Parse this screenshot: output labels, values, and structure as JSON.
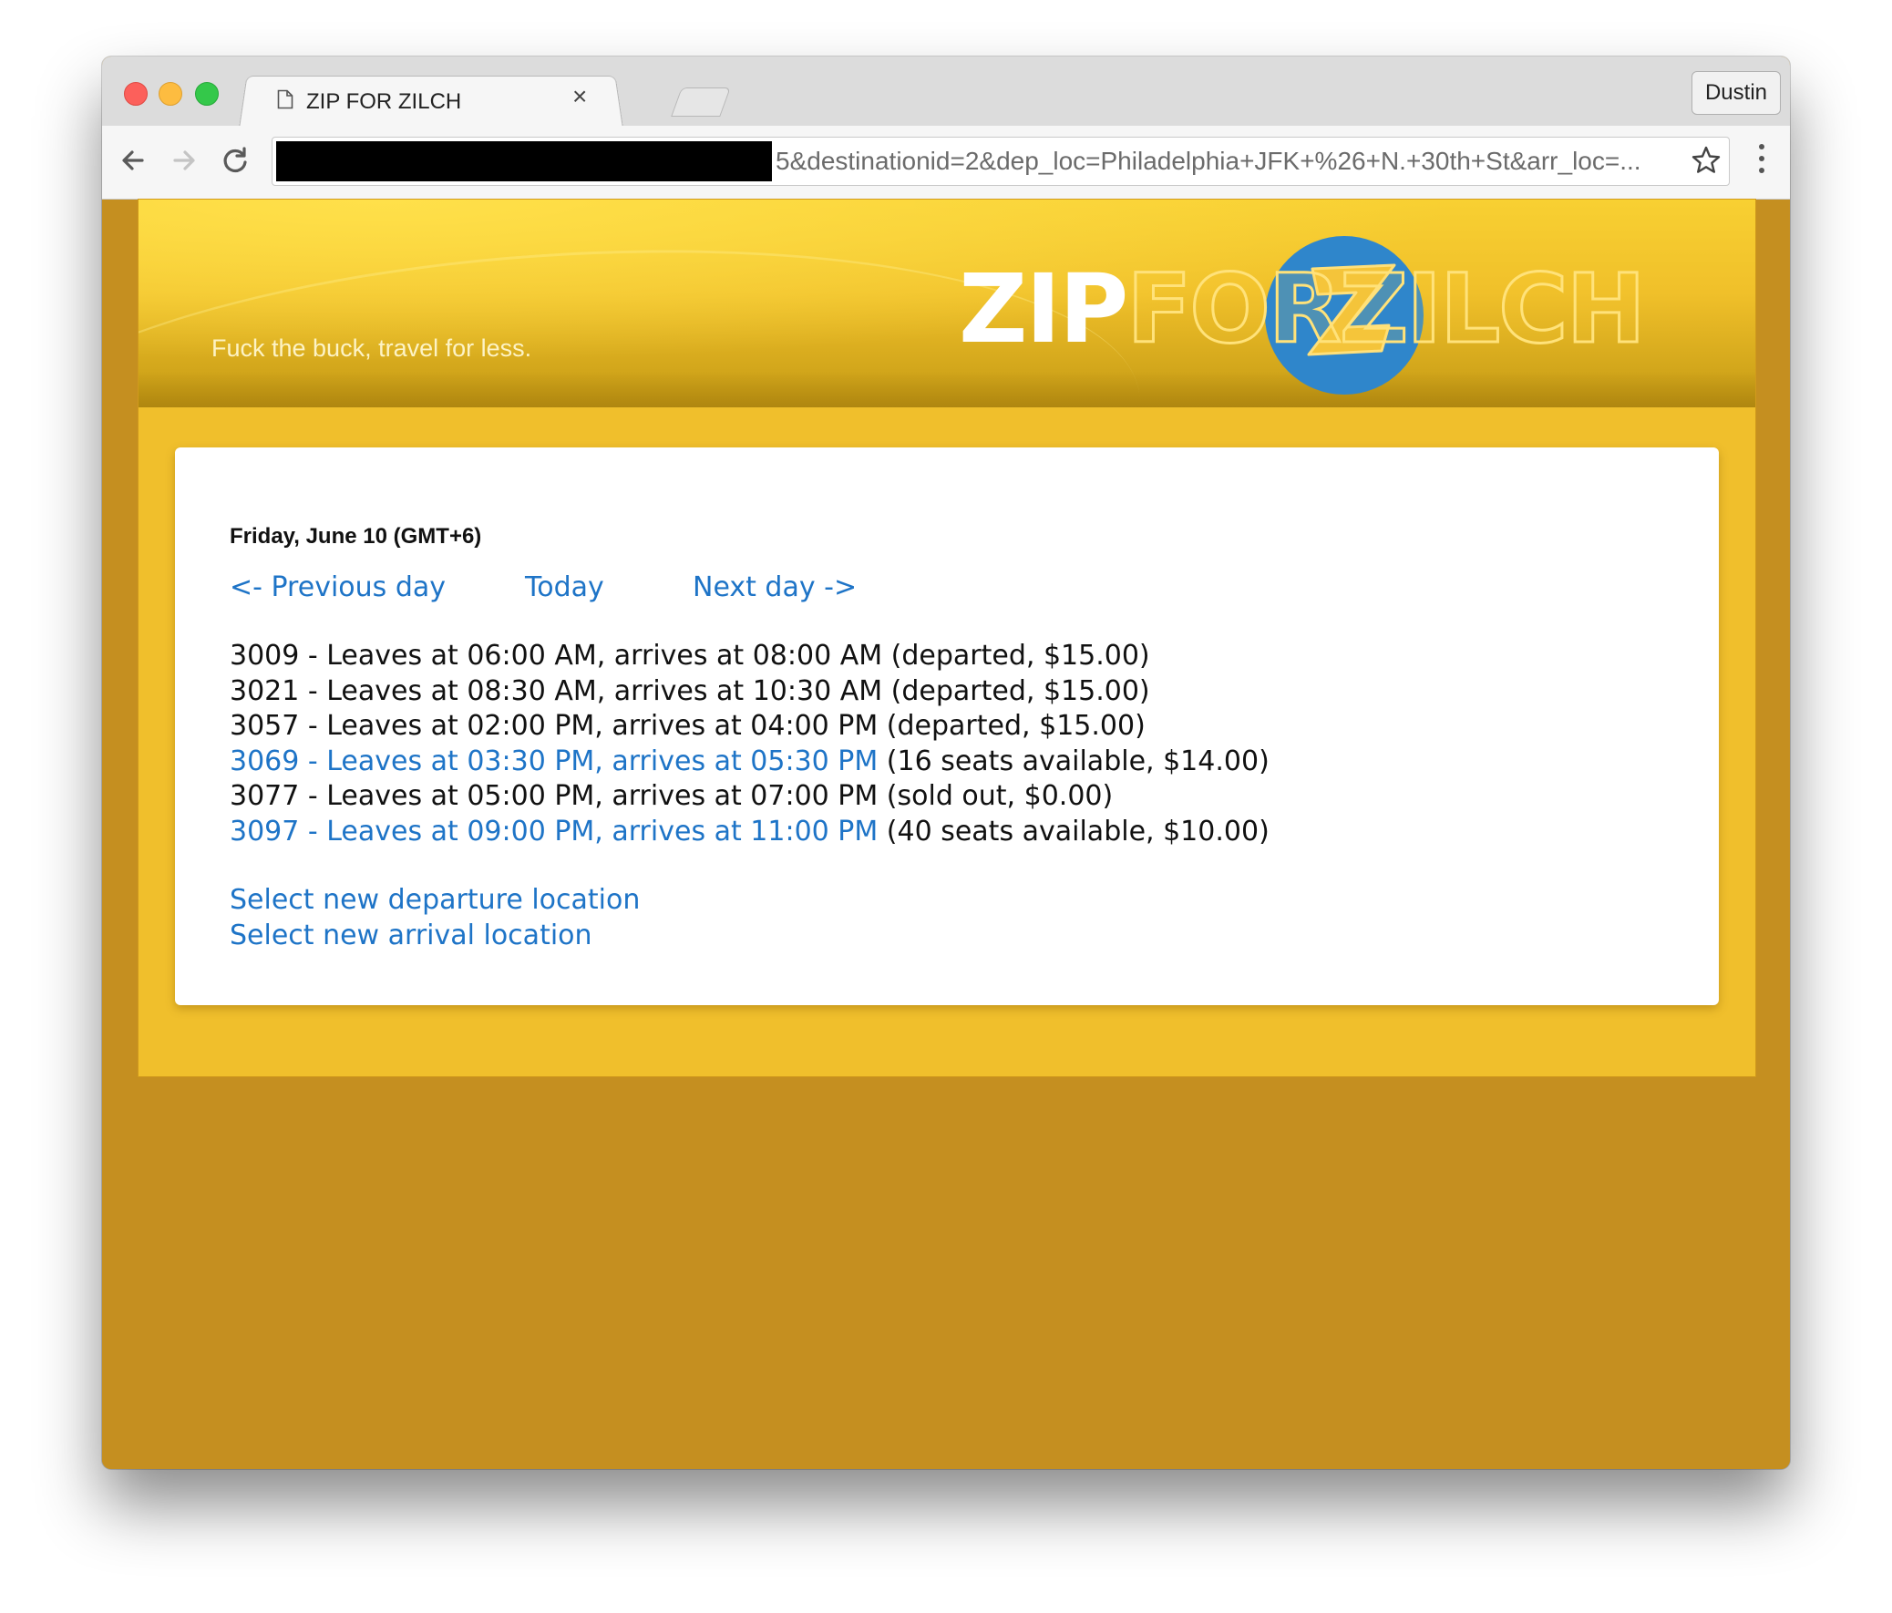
{
  "browser": {
    "tab_title": "ZIP FOR ZILCH",
    "tab_close": "×",
    "profile_name": "Dustin",
    "url_visible": "5&destinationid=2&dep_loc=Philadelphia+JFK+%26+N.+30th+St&arr_loc=..."
  },
  "site": {
    "tagline": "Fuck the buck, travel for less.",
    "logo_zip": "ZIP",
    "logo_rest": "FORZILCH",
    "colors": {
      "accent_link": "#1e74c7",
      "brand_yellow": "#f0bf2c",
      "background": "#c58f20",
      "logo_blue": "#2f86cb"
    }
  },
  "schedule": {
    "date_heading": "Friday, June 10 (GMT+6)",
    "nav": {
      "prev": "<- Previous day",
      "today": "Today",
      "next": "Next day ->"
    },
    "trips": [
      {
        "text": "3009 - Leaves at 06:00 AM, arrives at 08:00 AM",
        "status": " (departed, $15.00)",
        "link": false
      },
      {
        "text": "3021 - Leaves at 08:30 AM, arrives at 10:30 AM",
        "status": " (departed, $15.00)",
        "link": false
      },
      {
        "text": "3057 - Leaves at 02:00 PM, arrives at 04:00 PM",
        "status": " (departed, $15.00)",
        "link": false
      },
      {
        "text": "3069 - Leaves at 03:30 PM, arrives at 05:30 PM",
        "status": " (16 seats available, $14.00)",
        "link": true
      },
      {
        "text": "3077 - Leaves at 05:00 PM, arrives at 07:00 PM",
        "status": " (sold out, $0.00)",
        "link": false
      },
      {
        "text": "3097 - Leaves at 09:00 PM, arrives at 11:00 PM",
        "status": " (40 seats available, $10.00)",
        "link": true
      }
    ],
    "select_departure": "Select new departure location",
    "select_arrival": "Select new arrival location"
  }
}
